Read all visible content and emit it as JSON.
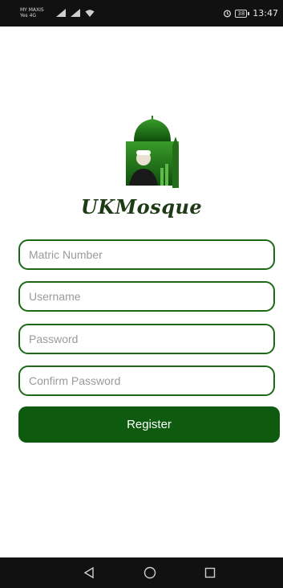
{
  "status_bar": {
    "carrier_line1": "MY MAXIS",
    "carrier_line2": "Yes 4G",
    "battery": "38",
    "time": "13:47",
    "icons": [
      "signal-icon",
      "signal-icon",
      "wifi-icon",
      "alarm-icon",
      "battery-icon"
    ]
  },
  "app": {
    "name": "UKMosque",
    "logo_icon": "mosque-logo-icon",
    "brand_color": "#0e5a0e"
  },
  "form": {
    "matric_placeholder": "Matric Number",
    "username_placeholder": "Username",
    "password_placeholder": "Password",
    "confirm_password_placeholder": "Confirm Password",
    "register_label": "Register"
  },
  "nav_bar": {
    "icons": [
      "back-icon",
      "home-icon",
      "recent-apps-icon"
    ]
  }
}
